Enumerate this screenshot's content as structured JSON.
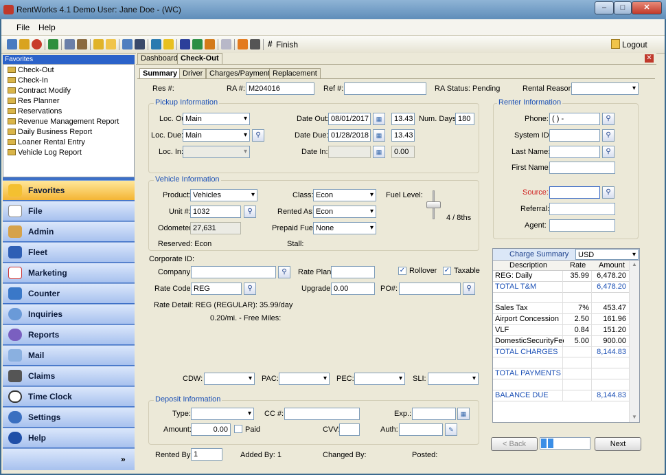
{
  "window": {
    "title": "RentWorks 4.1 Demo  User: Jane Doe - (WC)",
    "minimize": "–",
    "maximize": "□",
    "close": "✕"
  },
  "menu": {
    "file": "File",
    "help": "Help"
  },
  "toolbar": {
    "finish": "Finish",
    "logout": "Logout"
  },
  "favorites": {
    "header": "Favorites",
    "items": [
      "Check-Out",
      "Check-In",
      "Contract Modify",
      "Res Planner",
      "Reservations",
      "Revenue Management Report",
      "Daily Business Report",
      "Loaner Rental Entry",
      "Vehicle Log Report"
    ]
  },
  "nav": [
    "Favorites",
    "File",
    "Admin",
    "Fleet",
    "Marketing",
    "Counter",
    "Inquiries",
    "Reports",
    "Mail",
    "Claims",
    "Time Clock",
    "Settings",
    "Help"
  ],
  "tabs": {
    "dashboard": "Dashboard",
    "checkout": "Check-Out"
  },
  "subtabs": [
    "Summary",
    "Driver",
    "Charges/Payments",
    "Replacement"
  ],
  "header": {
    "res_label": "Res #:",
    "ra_label": "RA #:",
    "ra_value": "M204016",
    "ref_label": "Ref #:",
    "status": "RA Status: Pending",
    "reason_label": "Rental Reason:"
  },
  "pickup": {
    "legend": "Pickup Information",
    "loc_out_label": "Loc. Out:",
    "loc_out": "Main",
    "loc_due_label": "Loc. Due:",
    "loc_due": "Main",
    "loc_in_label": "Loc. In:",
    "date_out_label": "Date Out:",
    "date_out": "08/01/2017",
    "time_out": "13.43",
    "num_days_label": "Num. Days:",
    "num_days": "180",
    "date_due_label": "Date Due:",
    "date_due": "01/28/2018",
    "time_due": "13.43",
    "date_in_label": "Date In:",
    "time_in": "0.00"
  },
  "vehicle": {
    "legend": "Vehicle Information",
    "product_label": "Product:",
    "product": "Vehicles",
    "unit_label": "Unit #:",
    "unit": "1032",
    "odometer_label": "Odometer:",
    "odometer": "27,631",
    "reserved": "Reserved: Econ",
    "class_label": "Class:",
    "class": "Econ",
    "rented_as_label": "Rented As:",
    "rented_as": "Econ",
    "prepaid_label": "Prepaid Fuel:",
    "prepaid": "None",
    "stall": "Stall:",
    "fuel_label": "Fuel Level:",
    "fuel_value": "4 / 8ths",
    "fuel_level": 0.5
  },
  "renter": {
    "legend": "Renter Information",
    "phone_label": "Phone:",
    "phone": "(   )   -",
    "system_label": "System ID:",
    "last_label": "Last Name:",
    "first_label": "First Name:",
    "source_label": "Source:",
    "referral_label": "Referral:",
    "agent_label": "Agent:"
  },
  "corporate": {
    "corp_label": "Corporate ID:",
    "company_label": "Company:",
    "rate_plan_label": "Rate Plan:",
    "rollover": "Rollover",
    "taxable": "Taxable",
    "rate_code_label": "Rate Code:",
    "rate_code": "REG",
    "upgrade_label": "Upgrade:",
    "upgrade": "0.00",
    "po_label": "PO#:",
    "rate_detail": "Rate Detail: REG (REGULAR): 35.99/day",
    "miles": "0.20/mi. - Free Miles:"
  },
  "coverage": {
    "cdw": "CDW:",
    "pac": "PAC:",
    "pec": "PEC:",
    "sli": "SLI:"
  },
  "deposit": {
    "legend": "Deposit Information",
    "type_label": "Type:",
    "cc_label": "CC #:",
    "exp_label": "Exp.:",
    "amount_label": "Amount:",
    "amount": "0.00",
    "paid": "Paid",
    "cvv_label": "CVV:",
    "auth_label": "Auth:"
  },
  "footer": {
    "rented_by_label": "Rented By:",
    "rented_by": "1",
    "added_by": "Added By: 1",
    "changed_by": "Changed By:",
    "posted": "Posted:"
  },
  "charge_summary": {
    "title": "Charge Summary",
    "currency": "USD",
    "headers": [
      "Description",
      "Rate",
      "Amount"
    ],
    "rows": [
      {
        "desc": "REG: Daily",
        "rate": "35.99",
        "amount": "6,478.20",
        "blue": false
      },
      {
        "desc": "TOTAL T&M",
        "rate": "",
        "amount": "6,478.20",
        "blue": true
      },
      {
        "desc": "",
        "rate": "",
        "amount": "",
        "blue": false
      },
      {
        "desc": "Sales Tax",
        "rate": "7%",
        "amount": "453.47",
        "blue": false
      },
      {
        "desc": "Airport Concession",
        "rate": "2.50",
        "amount": "161.96",
        "blue": false
      },
      {
        "desc": "VLF",
        "rate": "0.84",
        "amount": "151.20",
        "blue": false
      },
      {
        "desc": "DomesticSecurityFee",
        "rate": "5.00",
        "amount": "900.00",
        "blue": false
      },
      {
        "desc": "TOTAL CHARGES",
        "rate": "",
        "amount": "8,144.83",
        "blue": true
      },
      {
        "desc": "",
        "rate": "",
        "amount": "",
        "blue": false
      },
      {
        "desc": "TOTAL PAYMENTS",
        "rate": "",
        "amount": "",
        "blue": true
      },
      {
        "desc": "",
        "rate": "",
        "amount": "",
        "blue": false
      },
      {
        "desc": "BALANCE DUE",
        "rate": "",
        "amount": "8,144.83",
        "blue": true
      }
    ]
  },
  "wizard": {
    "back": "< Back",
    "next": "Next"
  }
}
